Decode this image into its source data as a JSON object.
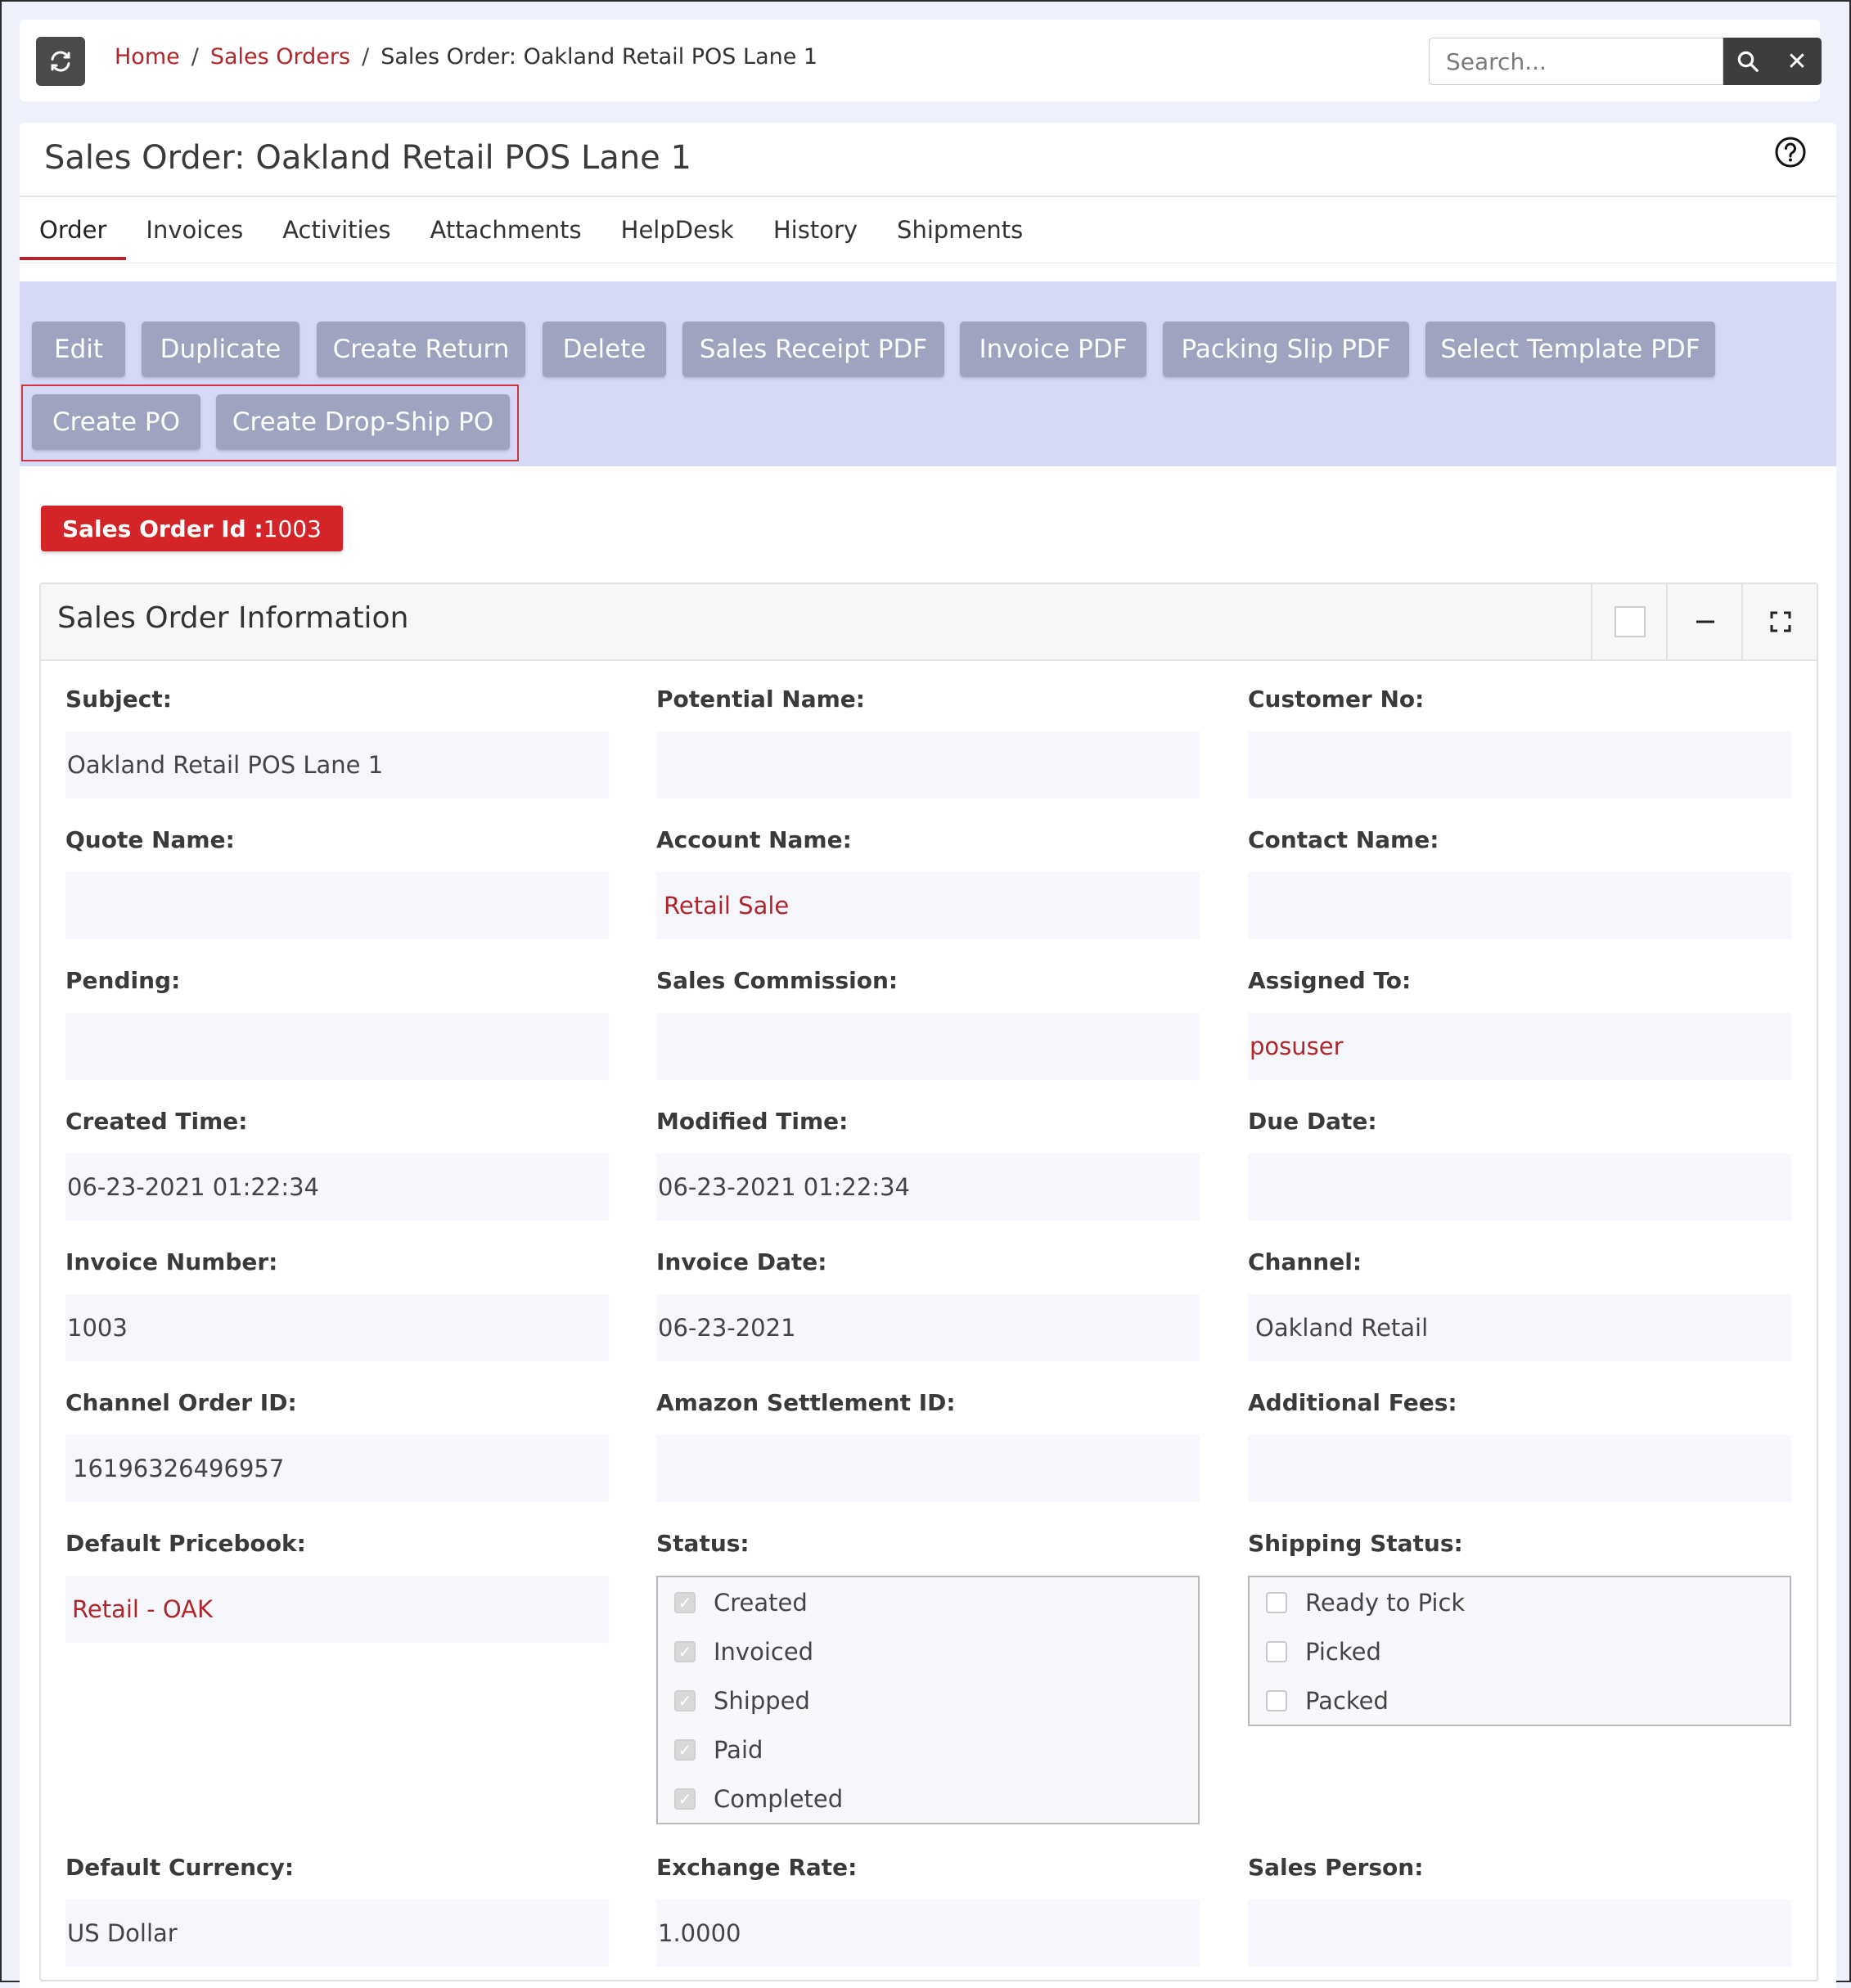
{
  "breadcrumb": {
    "home": "Home",
    "sep": "/",
    "module": "Sales Orders",
    "current": "Sales Order: Oakland Retail POS Lane 1"
  },
  "search": {
    "placeholder": "Search..."
  },
  "page": {
    "title": "Sales Order: Oakland Retail POS Lane 1"
  },
  "tabs": [
    "Order",
    "Invoices",
    "Activities",
    "Attachments",
    "HelpDesk",
    "History",
    "Shipments"
  ],
  "actions": {
    "edit": "Edit",
    "duplicate": "Duplicate",
    "create_return": "Create Return",
    "delete": "Delete",
    "sales_receipt_pdf": "Sales Receipt PDF",
    "invoice_pdf": "Invoice PDF",
    "packing_slip_pdf": "Packing Slip PDF",
    "select_template_pdf": "Select Template PDF",
    "create_po": "Create PO",
    "create_dropship_po": "Create Drop-Ship PO"
  },
  "badge": {
    "label": "Sales Order Id :",
    "value": "1003"
  },
  "card": {
    "title": "Sales Order Information"
  },
  "fields": {
    "subject": {
      "label": "Subject:",
      "value": "Oakland Retail POS Lane 1"
    },
    "potential_name": {
      "label": "Potential Name:",
      "value": ""
    },
    "customer_no": {
      "label": "Customer No:",
      "value": ""
    },
    "quote_name": {
      "label": "Quote Name:",
      "value": ""
    },
    "account_name": {
      "label": "Account Name:",
      "value": "Retail Sale"
    },
    "contact_name": {
      "label": "Contact Name:",
      "value": ""
    },
    "pending": {
      "label": "Pending:",
      "value": ""
    },
    "sales_commission": {
      "label": "Sales Commission:",
      "value": ""
    },
    "assigned_to": {
      "label": "Assigned To:",
      "value": "posuser"
    },
    "created_time": {
      "label": "Created Time:",
      "value": "06-23-2021 01:22:34"
    },
    "modified_time": {
      "label": "Modified Time:",
      "value": "06-23-2021 01:22:34"
    },
    "due_date": {
      "label": "Due Date:",
      "value": ""
    },
    "invoice_number": {
      "label": "Invoice Number:",
      "value": "1003"
    },
    "invoice_date": {
      "label": "Invoice Date:",
      "value": "06-23-2021"
    },
    "channel": {
      "label": "Channel:",
      "value": "Oakland Retail"
    },
    "channel_order_id": {
      "label": "Channel Order ID:",
      "value": "16196326496957"
    },
    "amazon_settlement_id": {
      "label": "Amazon Settlement ID:",
      "value": ""
    },
    "additional_fees": {
      "label": "Additional Fees:",
      "value": ""
    },
    "default_pricebook": {
      "label": "Default Pricebook:",
      "value": "Retail - OAK"
    },
    "status": {
      "label": "Status:"
    },
    "shipping_status": {
      "label": "Shipping Status:"
    },
    "default_currency": {
      "label": "Default Currency:",
      "value": "US Dollar"
    },
    "exchange_rate": {
      "label": "Exchange Rate:",
      "value": "1.0000"
    },
    "sales_person": {
      "label": "Sales Person:",
      "value": ""
    }
  },
  "status_options": [
    {
      "label": "Created",
      "checked": true
    },
    {
      "label": "Invoiced",
      "checked": true
    },
    {
      "label": "Shipped",
      "checked": true
    },
    {
      "label": "Paid",
      "checked": true
    },
    {
      "label": "Completed",
      "checked": true
    }
  ],
  "shipping_options": [
    {
      "label": "Ready to Pick",
      "checked": false
    },
    {
      "label": "Picked",
      "checked": false
    },
    {
      "label": "Packed",
      "checked": false
    }
  ],
  "colors": {
    "accent": "#b0262a",
    "badge": "#d52427",
    "button": "#9ea4c0",
    "actionbar": "#d5d9f5"
  },
  "icons": [
    "refresh-icon",
    "search-icon",
    "close-icon",
    "help-icon",
    "checkbox-icon",
    "minimize-icon",
    "expand-icon"
  ]
}
